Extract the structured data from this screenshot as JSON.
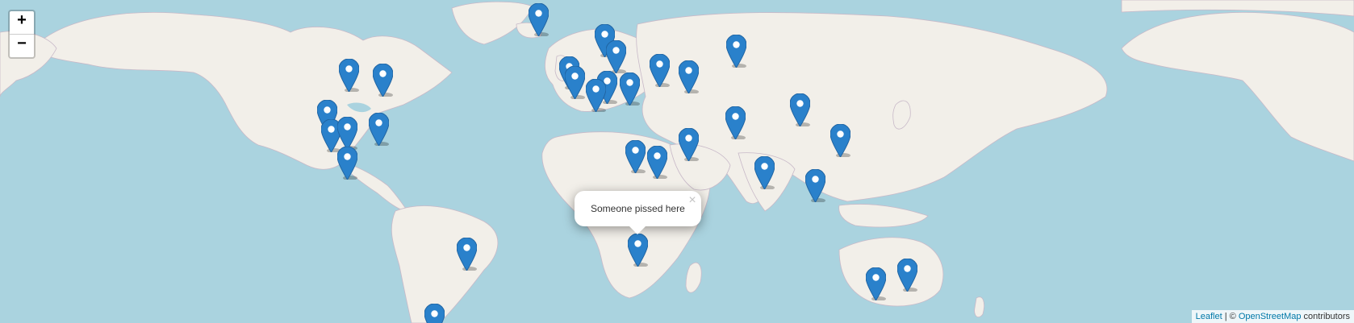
{
  "zoom": {
    "in_label": "+",
    "out_label": "−"
  },
  "popup": {
    "text": "Someone pissed here",
    "close_label": "×"
  },
  "attribution": {
    "leaflet": "Leaflet",
    "separator": " | © ",
    "osm": "OpenStreetMap",
    "suffix": " contributors"
  },
  "colors": {
    "water": "#aad3df",
    "land": "#f2efe9",
    "marker": "#2a81cb"
  },
  "marker_icon": "map-pin-icon",
  "marker_count": 34
}
